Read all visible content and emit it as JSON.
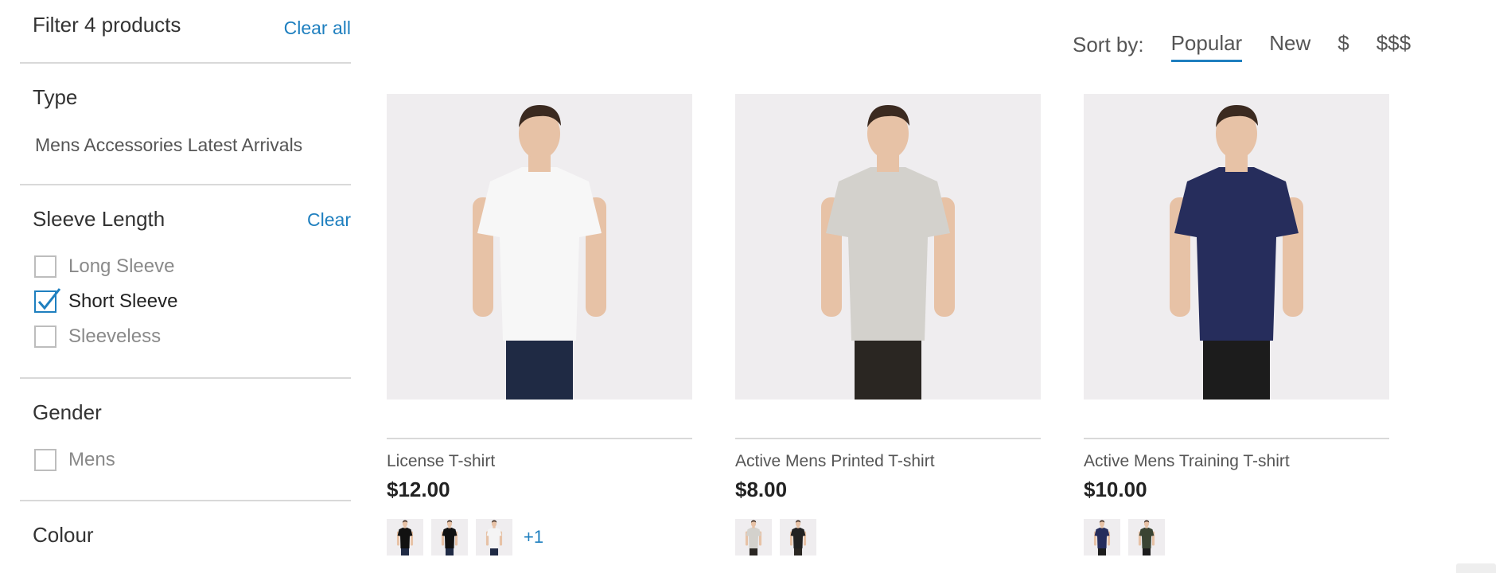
{
  "filters": {
    "title": "Filter 4 products",
    "clear_all": "Clear all",
    "type": {
      "title": "Type",
      "value": "Mens Accessories Latest Arrivals"
    },
    "sleeve": {
      "title": "Sleeve Length",
      "clear": "Clear",
      "options": [
        {
          "label": "Long Sleeve",
          "checked": false
        },
        {
          "label": "Short Sleeve",
          "checked": true
        },
        {
          "label": "Sleeveless",
          "checked": false
        }
      ]
    },
    "gender": {
      "title": "Gender",
      "options": [
        {
          "label": "Mens",
          "checked": false
        }
      ]
    },
    "colour": {
      "title": "Colour"
    }
  },
  "sort": {
    "label": "Sort by:",
    "options": [
      "Popular",
      "New",
      "$",
      "$$$"
    ],
    "active": "Popular"
  },
  "products": [
    {
      "name": "License T-shirt",
      "price": "$12.00",
      "shirt_color": "#f7f7f7",
      "pants_color": "#1f2a44",
      "swatches": [
        "#111111",
        "#111111",
        "#f4f4f4"
      ],
      "more": "+1"
    },
    {
      "name": "Active Mens Printed T-shirt",
      "price": "$8.00",
      "shirt_color": "#d3d1cc",
      "pants_color": "#2a2622",
      "swatches": [
        "#d3d1cc",
        "#222222"
      ],
      "more": ""
    },
    {
      "name": "Active Mens Training T-shirt",
      "price": "$10.00",
      "shirt_color": "#262d5c",
      "pants_color": "#1c1c1c",
      "swatches": [
        "#262d5c",
        "#3a4433"
      ],
      "more": ""
    }
  ],
  "colors": {
    "accent": "#1e7fbf",
    "image_bg": "#efedef",
    "skin": "#e7c2a6",
    "hair": "#3b2a20"
  }
}
